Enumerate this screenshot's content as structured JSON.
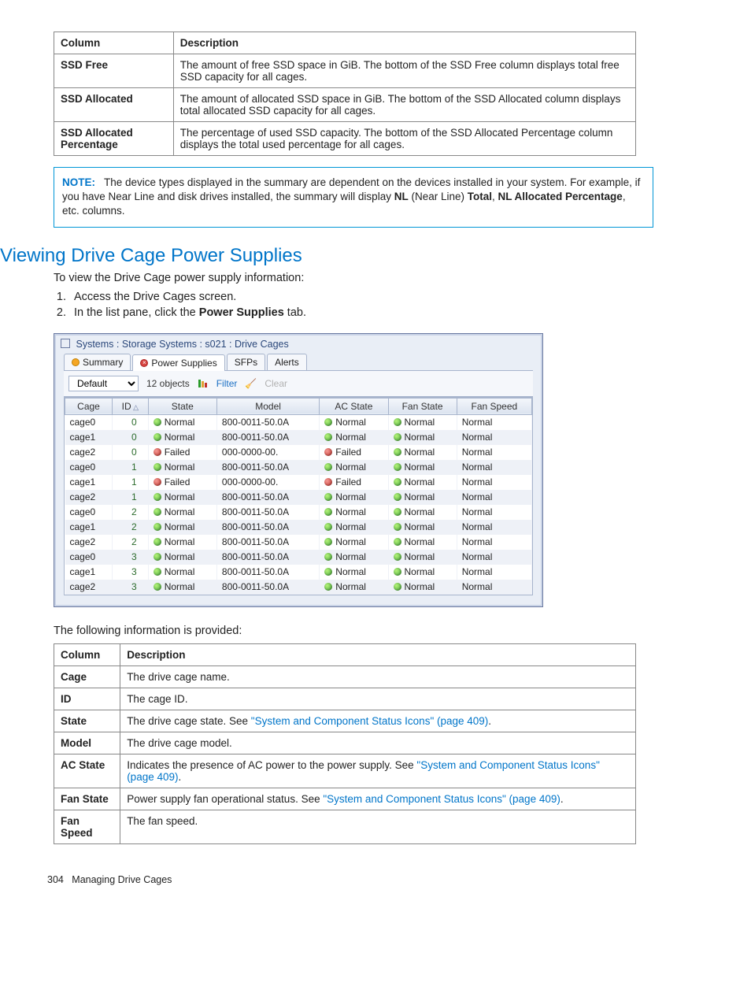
{
  "table1": {
    "headers": [
      "Column",
      "Description"
    ],
    "rows": [
      {
        "col": "SSD Free",
        "desc": "The amount of free SSD space in GiB. The bottom of the SSD Free column displays total free SSD capacity for all cages."
      },
      {
        "col": "SSD Allocated",
        "desc": "The amount of allocated SSD space in GiB. The bottom of the SSD Allocated column displays total allocated SSD capacity for all cages."
      },
      {
        "col": "SSD Allocated Percentage",
        "desc": "The percentage of used SSD capacity. The bottom of the SSD Allocated Percentage column displays the total used percentage for all cages."
      }
    ]
  },
  "note": {
    "label": "NOTE:",
    "text_pre": "The device types displayed in the summary are dependent on the devices installed in your system. For example, if you have Near Line and disk drives installed, the summary will display ",
    "nl": "NL",
    "nl_paren": " (Near Line) ",
    "total": "Total",
    "sep": ", ",
    "nl_alloc": "NL Allocated Percentage",
    "tail": ", etc. columns."
  },
  "heading": "Viewing Drive Cage Power Supplies",
  "intro": "To view the Drive Cage power supply information:",
  "steps": {
    "s1": "Access the Drive Cages screen.",
    "s2_a": "In the list pane, click the ",
    "s2_b": "Power Supplies",
    "s2_c": " tab."
  },
  "app": {
    "title": "Systems : Storage Systems : s021 : Drive Cages",
    "tabs": {
      "summary": "Summary",
      "power": "Power Supplies",
      "sfps": "SFPs",
      "alerts": "Alerts"
    },
    "toolbar": {
      "filter_preset": "Default",
      "count": "12 objects",
      "filter": "Filter",
      "clear": "Clear"
    },
    "columns": [
      "Cage",
      "ID",
      "State",
      "Model",
      "AC State",
      "Fan State",
      "Fan Speed"
    ],
    "rows": [
      {
        "cage": "cage0",
        "id": "0",
        "state": "Normal",
        "model": "800-0011-50.0A",
        "ac": "Normal",
        "fan": "Normal",
        "speed": "Normal"
      },
      {
        "cage": "cage1",
        "id": "0",
        "state": "Normal",
        "model": "800-0011-50.0A",
        "ac": "Normal",
        "fan": "Normal",
        "speed": "Normal"
      },
      {
        "cage": "cage2",
        "id": "0",
        "state": "Failed",
        "model": "000-0000-00.",
        "ac": "Failed",
        "fan": "Normal",
        "speed": "Normal"
      },
      {
        "cage": "cage0",
        "id": "1",
        "state": "Normal",
        "model": "800-0011-50.0A",
        "ac": "Normal",
        "fan": "Normal",
        "speed": "Normal"
      },
      {
        "cage": "cage1",
        "id": "1",
        "state": "Failed",
        "model": "000-0000-00.",
        "ac": "Failed",
        "fan": "Normal",
        "speed": "Normal"
      },
      {
        "cage": "cage2",
        "id": "1",
        "state": "Normal",
        "model": "800-0011-50.0A",
        "ac": "Normal",
        "fan": "Normal",
        "speed": "Normal"
      },
      {
        "cage": "cage0",
        "id": "2",
        "state": "Normal",
        "model": "800-0011-50.0A",
        "ac": "Normal",
        "fan": "Normal",
        "speed": "Normal"
      },
      {
        "cage": "cage1",
        "id": "2",
        "state": "Normal",
        "model": "800-0011-50.0A",
        "ac": "Normal",
        "fan": "Normal",
        "speed": "Normal"
      },
      {
        "cage": "cage2",
        "id": "2",
        "state": "Normal",
        "model": "800-0011-50.0A",
        "ac": "Normal",
        "fan": "Normal",
        "speed": "Normal"
      },
      {
        "cage": "cage0",
        "id": "3",
        "state": "Normal",
        "model": "800-0011-50.0A",
        "ac": "Normal",
        "fan": "Normal",
        "speed": "Normal"
      },
      {
        "cage": "cage1",
        "id": "3",
        "state": "Normal",
        "model": "800-0011-50.0A",
        "ac": "Normal",
        "fan": "Normal",
        "speed": "Normal"
      },
      {
        "cage": "cage2",
        "id": "3",
        "state": "Normal",
        "model": "800-0011-50.0A",
        "ac": "Normal",
        "fan": "Normal",
        "speed": "Normal"
      }
    ]
  },
  "after_shot": "The following information is provided:",
  "table2": {
    "headers": [
      "Column",
      "Description"
    ],
    "rows": [
      {
        "col": "Cage",
        "desc_plain": "The drive cage name."
      },
      {
        "col": "ID",
        "desc_plain": "The cage ID."
      },
      {
        "col": "State",
        "desc_pre": "The drive cage state. See ",
        "link": "\"System and Component Status Icons\" (page 409)",
        "desc_post": "."
      },
      {
        "col": "Model",
        "desc_plain": "The drive cage model."
      },
      {
        "col": "AC State",
        "desc_pre": "Indicates the presence of AC power to the power supply. See ",
        "link": "\"System and Component Status Icons\" (page 409)",
        "desc_post": "."
      },
      {
        "col": "Fan State",
        "desc_pre": "Power supply fan operational status. See ",
        "link": "\"System and Component Status Icons\" (page 409)",
        "desc_post": "."
      },
      {
        "col": "Fan Speed",
        "desc_plain": "The fan speed."
      }
    ]
  },
  "footer": {
    "page": "304",
    "title": "Managing Drive Cages"
  }
}
